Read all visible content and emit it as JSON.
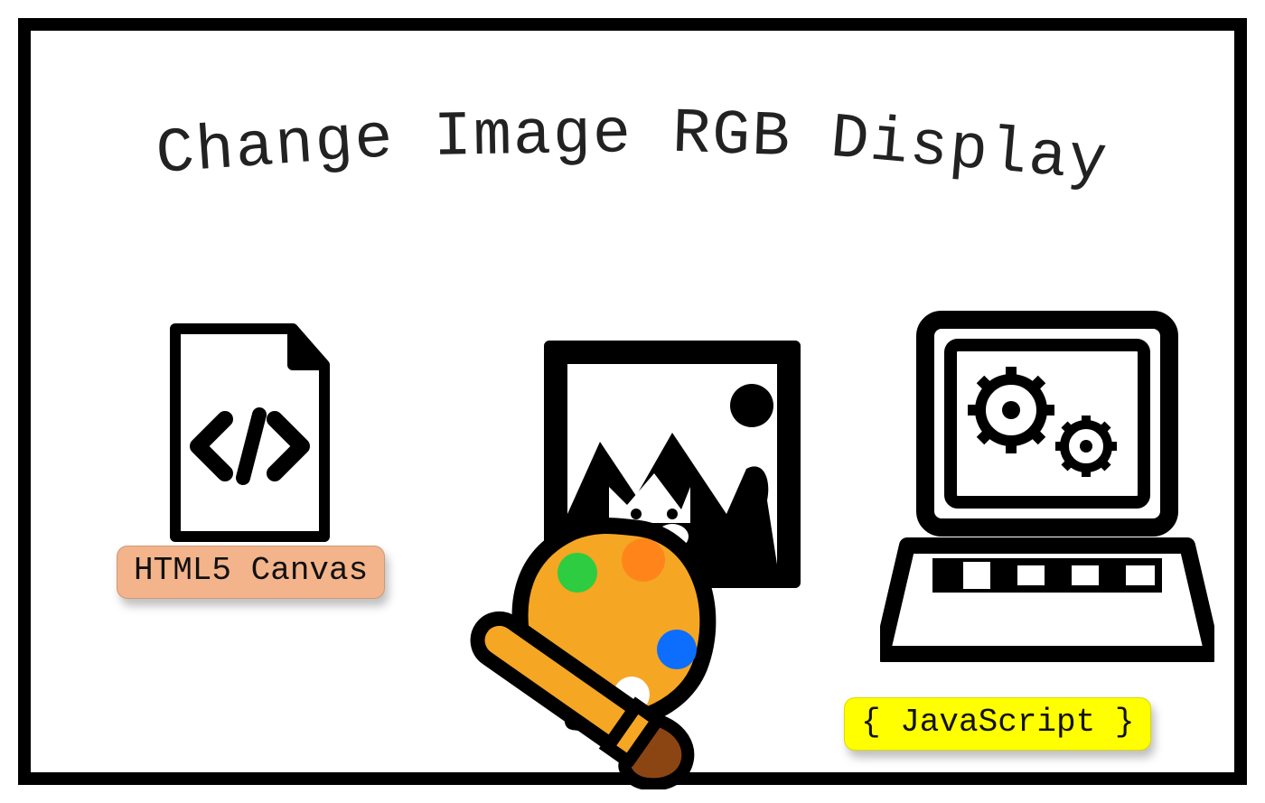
{
  "title_words": {
    "w1": "Change",
    "w2": "Image",
    "w3": "RGB",
    "w4": "Display"
  },
  "badges": {
    "html5": "HTML5 Canvas",
    "javascript": "{ JavaScript }"
  },
  "icons": {
    "code_file": "code-file-icon",
    "picture": "picture-frame-icon",
    "palette": "paint-palette-icon",
    "laptop": "laptop-gears-icon"
  },
  "colors": {
    "border": "#000000",
    "badge_html5_bg": "#f3b48b",
    "badge_js_bg": "#ffff00",
    "palette_body": "#f5a623",
    "palette_spot_green": "#2ecc40",
    "palette_spot_amber": "#ff851b",
    "palette_spot_brown": "#8b4513",
    "palette_spot_blue": "#0d6efd",
    "palette_spot_white": "#ffffff"
  }
}
